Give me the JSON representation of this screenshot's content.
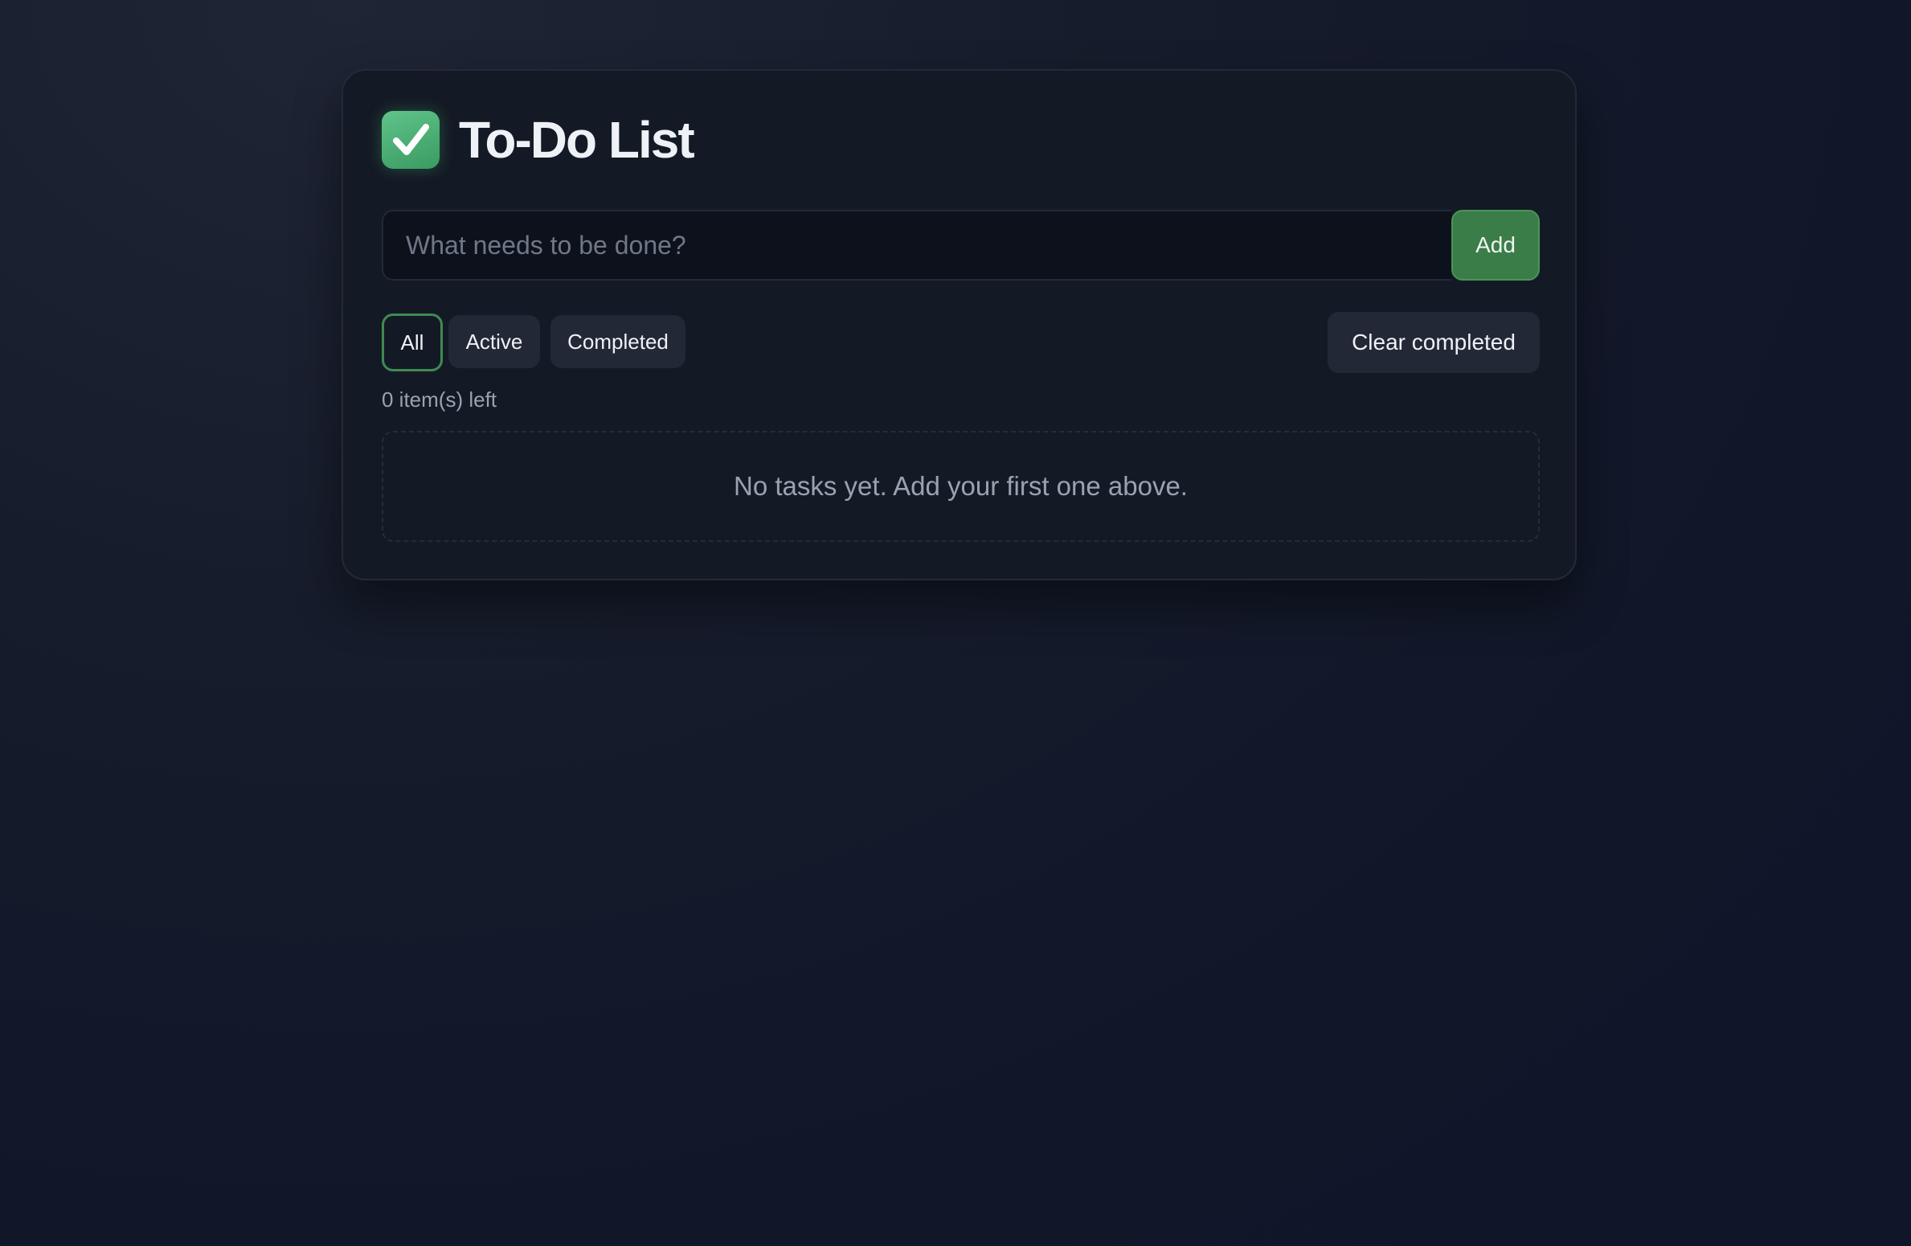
{
  "app": {
    "title": "To-Do List",
    "logo_icon": "check-icon",
    "accent_color": "#3a7d48"
  },
  "input": {
    "placeholder": "What needs to be done?",
    "value": "",
    "add_label": "Add"
  },
  "filters": {
    "items": [
      {
        "label": "All",
        "selected": true
      },
      {
        "label": "Active",
        "selected": false
      },
      {
        "label": "Completed",
        "selected": false
      }
    ],
    "clear_label": "Clear completed"
  },
  "status": {
    "items_left": "0 item(s) left"
  },
  "list": {
    "empty_message": "No tasks yet. Add your first one above."
  }
}
